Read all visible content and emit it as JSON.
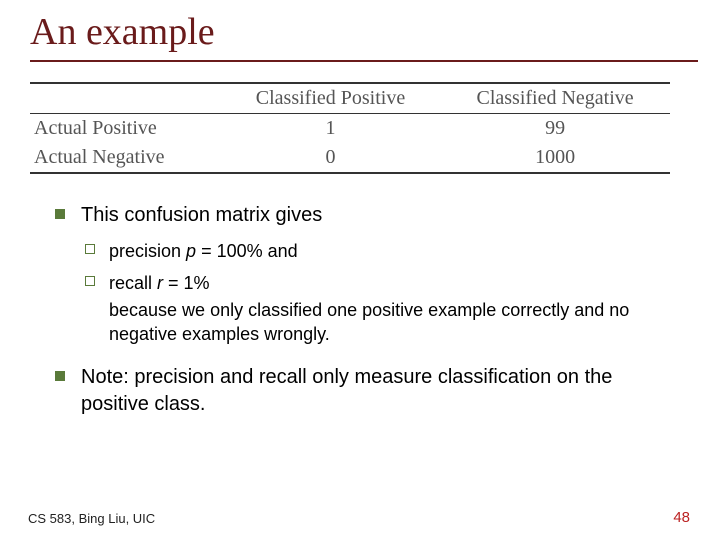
{
  "title": "An example",
  "table": {
    "col1": "Classified Positive",
    "col2": "Classified Negative",
    "row1_label": "Actual Positive",
    "row1_c1": "1",
    "row1_c2": "99",
    "row2_label": "Actual Negative",
    "row2_c1": "0",
    "row2_c2": "1000"
  },
  "bullet1": "This confusion matrix gives",
  "sub1_pre": "precision ",
  "sub1_var": "p",
  "sub1_post": " = 100% and",
  "sub2_pre": "recall ",
  "sub2_var": "r",
  "sub2_post": " = 1%",
  "expl": "because we only classified one positive example correctly and no negative examples wrongly.",
  "bullet2": "Note: precision and recall only measure classification on the positive class.",
  "footer_left": "CS 583, Bing Liu, UIC",
  "footer_right": "48"
}
